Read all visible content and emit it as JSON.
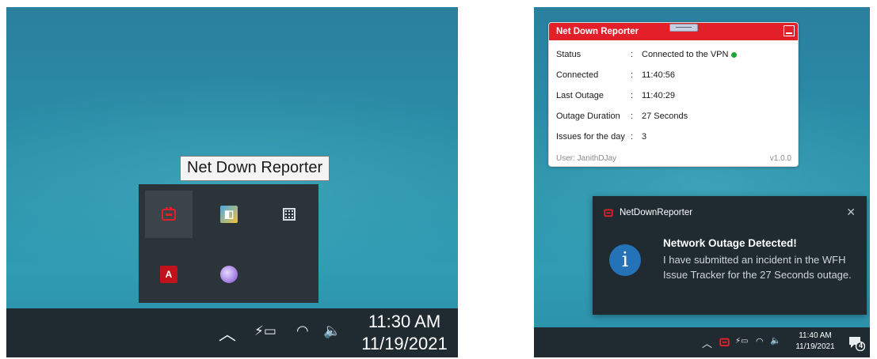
{
  "left": {
    "tooltip": "Net Down Reporter",
    "tray_icons": [
      "netdown-icon",
      "monitor-app-icon",
      "calculator-icon",
      "adobe-icon",
      "torbrowser-icon"
    ],
    "taskbar": {
      "time": "11:30 AM",
      "date": "11/19/2021"
    }
  },
  "right": {
    "app": {
      "title": "Net Down Reporter",
      "rows": [
        {
          "label": "Status",
          "value": "Connected to the VPN"
        },
        {
          "label": "Connected",
          "value": "11:40:56"
        },
        {
          "label": "Last Outage",
          "value": "11:40:29"
        },
        {
          "label": "Outage Duration",
          "value": "27 Seconds"
        },
        {
          "label": "Issues for the day",
          "value": "3"
        }
      ],
      "separator": ":",
      "user": "User:  JanithDJay",
      "version": "v1.0.0",
      "status_color": "#1fa33a",
      "accent": "#e3202a"
    },
    "toast": {
      "app_name": "NetDownReporter",
      "title": "Network Outage Detected!",
      "message": "I have submitted an incident in the WFH Issue Tracker for the 27 Seconds outage."
    },
    "taskbar": {
      "time": "11:40 AM",
      "date": "11/19/2021",
      "notif_count": "4"
    }
  }
}
